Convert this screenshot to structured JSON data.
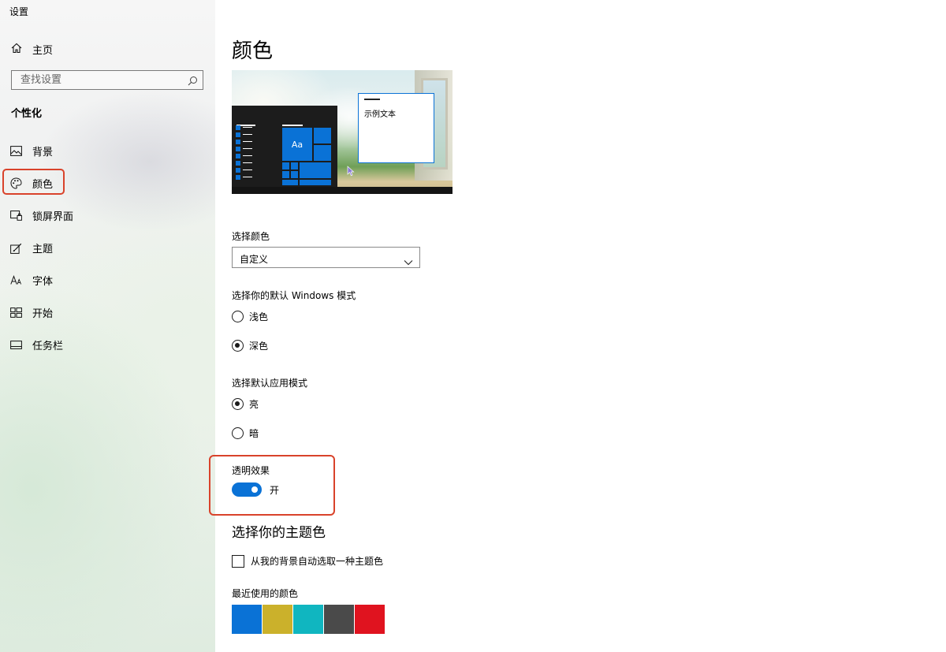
{
  "app": {
    "title": "设置"
  },
  "sidebar": {
    "home_label": "主页",
    "search": {
      "placeholder": "查找设置"
    },
    "section_title": "个性化",
    "items": [
      {
        "label": "背景",
        "icon": "picture-icon"
      },
      {
        "label": "颜色",
        "icon": "palette-icon",
        "active": true
      },
      {
        "label": "锁屏界面",
        "icon": "lockscreen-icon"
      },
      {
        "label": "主题",
        "icon": "theme-brush-icon"
      },
      {
        "label": "字体",
        "icon": "font-icon"
      },
      {
        "label": "开始",
        "icon": "start-grid-icon"
      },
      {
        "label": "任务栏",
        "icon": "taskbar-icon"
      }
    ]
  },
  "main": {
    "title": "颜色",
    "preview": {
      "sample_text": "示例文本",
      "tile_label": "Aa"
    },
    "choose_color": {
      "label": "选择颜色",
      "selected": "自定义"
    },
    "windows_mode": {
      "label": "选择你的默认 Windows 模式",
      "options": [
        {
          "label": "浅色",
          "checked": false
        },
        {
          "label": "深色",
          "checked": true
        }
      ]
    },
    "app_mode": {
      "label": "选择默认应用模式",
      "options": [
        {
          "label": "亮",
          "checked": true
        },
        {
          "label": "暗",
          "checked": false
        }
      ]
    },
    "transparency": {
      "label": "透明效果",
      "state_label": "开",
      "on": true
    },
    "accent": {
      "title": "选择你的主题色",
      "auto_pick_label": "从我的背景自动选取一种主题色",
      "auto_pick_checked": false,
      "recent_label": "最近使用的颜色",
      "recent_colors": [
        "#0a72d6",
        "#cbb12b",
        "#10b6c0",
        "#4a4a4a",
        "#e0131f"
      ]
    }
  },
  "colors": {
    "accent": "#0a72d6",
    "highlight": "#d9432b"
  }
}
